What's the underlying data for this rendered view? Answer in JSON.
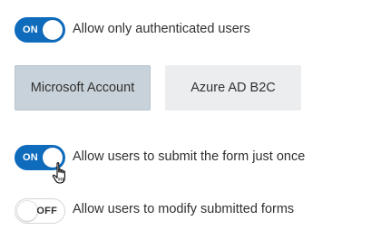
{
  "auth_only": {
    "state": "ON",
    "label": "Allow only authenticated users",
    "checked": true
  },
  "identity_providers": {
    "options": [
      {
        "label": "Microsoft Account",
        "selected": true
      },
      {
        "label": "Azure AD B2C",
        "selected": false
      }
    ]
  },
  "submit_once": {
    "state": "ON",
    "label": "Allow users to submit the form just once",
    "checked": true
  },
  "modify_submitted": {
    "state": "OFF",
    "label": "Allow users to modify submitted forms",
    "checked": false
  },
  "colors": {
    "toggle_on": "#0f6cbd",
    "button_selected": "#c8d2da",
    "button_unselected": "#ecedef"
  },
  "cursor": {
    "icon": "hand-pointer-icon"
  }
}
